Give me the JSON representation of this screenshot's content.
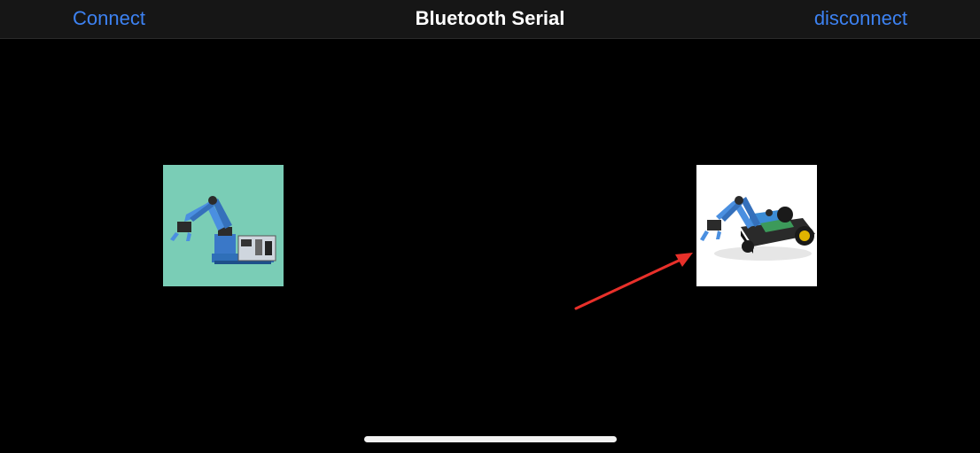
{
  "navbar": {
    "left_button": "Connect",
    "title": "Bluetooth Serial",
    "right_button": "disconnect"
  },
  "tiles": [
    {
      "icon": "robot-arm-kit-icon",
      "background": "#7acdb6"
    },
    {
      "icon": "robot-arm-car-kit-icon",
      "background": "#ffffff"
    }
  ],
  "colors": {
    "accent": "#3d82f2",
    "background": "#000000",
    "navbar": "#161616",
    "annotation_arrow": "#e8302a"
  }
}
